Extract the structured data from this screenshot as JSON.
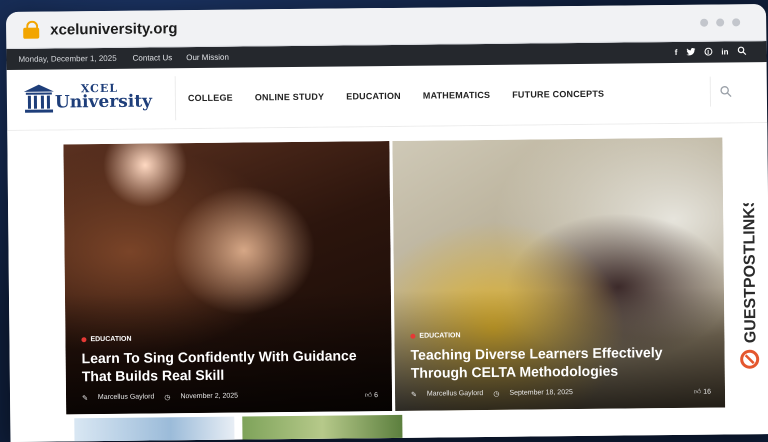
{
  "browser": {
    "url": "xceluniversity.org"
  },
  "topbar": {
    "date": "Monday, December 1, 2025",
    "links": [
      "Contact Us",
      "Our Mission"
    ],
    "social": [
      "f",
      "t",
      "p",
      "in"
    ]
  },
  "logo": {
    "line1": "XCEL",
    "line2": "University"
  },
  "nav": {
    "items": [
      "COLLEGE",
      "ONLINE STUDY",
      "EDUCATION",
      "MATHEMATICS",
      "FUTURE CONCEPTS"
    ]
  },
  "posts": [
    {
      "category": "EDUCATION",
      "title": "Learn To Sing Confidently With Guidance That Builds Real Skill",
      "author": "Marcellus Gaylord",
      "date": "November 2, 2025",
      "count": "6"
    },
    {
      "category": "EDUCATION",
      "title": "Teaching Diverse Learners Effectively Through CELTA Methodologies",
      "author": "Marcellus Gaylord",
      "date": "September 18, 2025",
      "count": "16"
    }
  ],
  "watermark": "GUESTPOSTLINKS",
  "colors": {
    "accent": "#e53935",
    "lock": "#f2a500",
    "logo": "#1e3e7a",
    "topbar": "#25282d"
  }
}
